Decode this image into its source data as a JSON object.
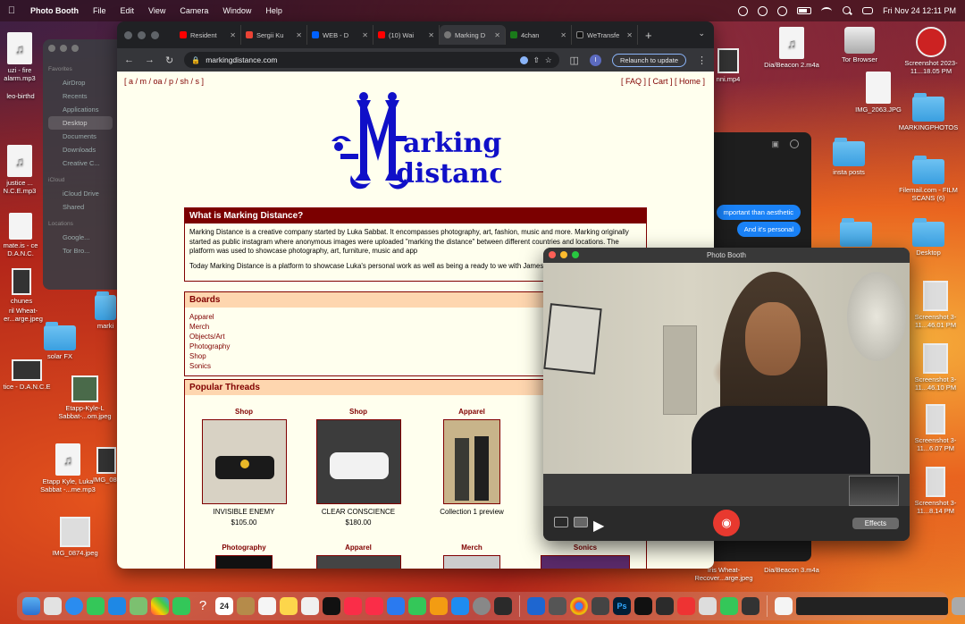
{
  "menubar": {
    "app_name": "Photo Booth",
    "menus": [
      "File",
      "Edit",
      "View",
      "Camera",
      "Window",
      "Help"
    ],
    "datetime": "Fri Nov 24  12:11 PM"
  },
  "desktop_left": [
    {
      "label": "uzi - fire alarm.mp3",
      "kind": "file"
    },
    {
      "label": "leo-birthd",
      "kind": "photo"
    },
    {
      "label": "justice ... N.C.E.mp3",
      "kind": "file"
    },
    {
      "label": "mate.is - ce D.A.N.C.",
      "kind": "file"
    },
    {
      "label": "chunes",
      "kind": "photo"
    },
    {
      "label": "ril Wheat- er...arge.jpeg",
      "kind": "photo"
    },
    {
      "label": "solar FX",
      "kind": "folder"
    },
    {
      "label": "tice - D.A.N.C.E",
      "kind": "photo"
    },
    {
      "label": "Etapp-Kyle-L Sabbat-...om.jpeg",
      "kind": "photo"
    },
    {
      "label": "IMG_087",
      "kind": "photo"
    },
    {
      "label": "Etapp Kyle, Luka Sabbat -...me.mp3",
      "kind": "file"
    },
    {
      "label": "IMG_0874.jpeg",
      "kind": "photo"
    },
    {
      "label": "marki",
      "kind": "folder"
    }
  ],
  "desktop_right": [
    {
      "label": "Dia/Beacon 2.m4a",
      "kind": "file"
    },
    {
      "label": "Tor Browser",
      "kind": "disk"
    },
    {
      "label": "Screenshot 2023-11...18.05 PM",
      "kind": "photo"
    },
    {
      "label": "IMG_2063.JPG",
      "kind": "file"
    },
    {
      "label": "MARKINGPHOTOS",
      "kind": "folder"
    },
    {
      "label": "insta posts",
      "kind": "folder"
    },
    {
      "label": "Filemail.com - FILM SCANS (6)",
      "kind": "folder"
    },
    {
      "label": "Desktop",
      "kind": "folder"
    },
    {
      "label": "Screenshot 3-11...46.01 PM",
      "kind": "photo"
    },
    {
      "label": "Screenshot 3-11...46.10 PM",
      "kind": "photo"
    },
    {
      "label": "Screenshot 3-11...6.07 PM",
      "kind": "photo"
    },
    {
      "label": "Screenshot 3-11...8.14 PM",
      "kind": "photo"
    },
    {
      "label": "nni.mp4",
      "kind": "photo"
    },
    {
      "label": "Iris Wheat- Recover...arge.jpeg",
      "kind": "photo"
    },
    {
      "label": "Dia/Beacon 3.m4a",
      "kind": "file"
    }
  ],
  "finder": {
    "favorites_title": "Favorites",
    "favorites": [
      "AirDrop",
      "Recents",
      "Applications",
      "Desktop",
      "Documents",
      "Downloads",
      "Creative C..."
    ],
    "icloud_title": "iCloud",
    "icloud": [
      "iCloud Drive",
      "Shared"
    ],
    "locations_title": "Locations",
    "locations": [
      "Google...",
      "Tor Bro..."
    ]
  },
  "messages": {
    "bubbles": [
      "mportant than aesthetic",
      "And it's personal"
    ]
  },
  "chrome": {
    "tabs": [
      {
        "title": "Resident",
        "color": "#ff0000"
      },
      {
        "title": "Sergii Ku",
        "color": "#ea4335"
      },
      {
        "title": "WEB - D",
        "color": "#0061fe"
      },
      {
        "title": "(10) Wai",
        "color": "#ff0000"
      },
      {
        "title": "Marking D",
        "color": "#777777"
      },
      {
        "title": "4chan",
        "color": "#1a7a1a"
      },
      {
        "title": "WeTransfe",
        "color": "#111111"
      }
    ],
    "active_tab_index": 4,
    "url": "markingdistance.com",
    "relaunch_label": "Relaunch to update",
    "profile_initial": "I"
  },
  "site": {
    "boards_nav": "[ a / m / oa / p / sh / s ]",
    "top_nav": "[ FAQ ]  [ Cart ]  [ Home ]",
    "logo_text_1": "arking",
    "logo_text_2": "distance",
    "about_title": "What is Marking Distance?",
    "about_p1": "Marking Distance is a creative company started by Luka Sabbat. It encompasses photography, art, fashion, music and more. Marking originally started as public instagram where anonymous images were uploaded \"marking the distance\" between different countries and locations. The platform was used to showcase photography, art, furniture, music and app",
    "about_p2": "Today Marking Distance is a platform to showcase Luka's personal work as well as being a ready to we with James Pierce.",
    "boards_title": "Boards",
    "boards": [
      "Apparel",
      "Merch",
      "Objects/Art",
      "Photography",
      "Shop",
      "Sonics"
    ],
    "threads_title": "Popular Threads",
    "threads": [
      {
        "category": "Shop",
        "name": "INVISIBLE ENEMY",
        "price": "$105.00",
        "img_color": "#2a2a2a"
      },
      {
        "category": "Shop",
        "name": "CLEAR CONSCIENCE",
        "price": "$180.00",
        "img_color": "#5a5a5a"
      },
      {
        "category": "Apparel",
        "name": "Collection 1 preview",
        "price": "",
        "img_color": "#c8b48a"
      }
    ],
    "threads_row2": [
      "Photography",
      "Apparel",
      "Merch",
      "Sonics"
    ]
  },
  "photobooth": {
    "title": "Photo Booth",
    "effects_label": "Effects"
  },
  "dock": {
    "calendar_day": "24"
  }
}
